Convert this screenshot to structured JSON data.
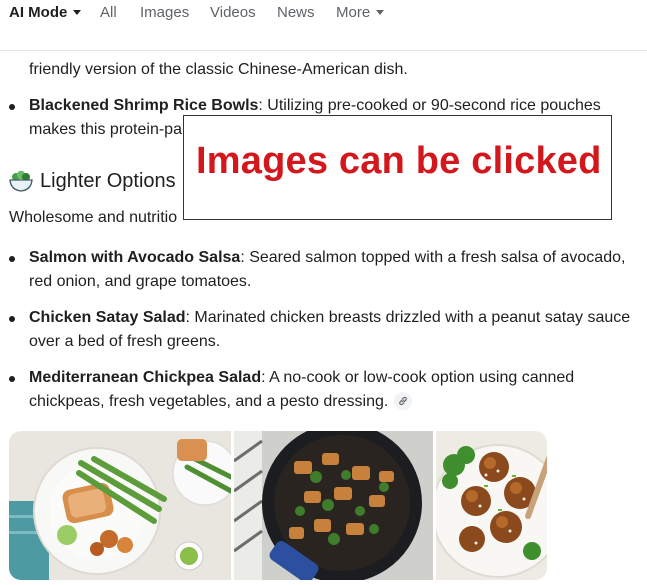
{
  "tabs": {
    "ai_mode": "AI Mode",
    "all": "All",
    "images": "Images",
    "videos": "Videos",
    "news": "News",
    "more": "More"
  },
  "previous_item": {
    "continuation": "friendly version of the classic Chinese-American dish."
  },
  "shrimp_item": {
    "title": "Blackened Shrimp Rice Bowls",
    "text_line1": ": Utilizing pre-cooked or 90-second rice pouches",
    "text_line2": "makes this protein-pa"
  },
  "section": {
    "heading": "Lighter Options",
    "intro": "Wholesome and nutritio",
    "icon": "salad-bowl-icon"
  },
  "lighter_items": [
    {
      "title": "Salmon with Avocado Salsa",
      "line1": ": Seared salmon topped with a fresh salsa of avocado,",
      "line2": "red onion, and grape tomatoes."
    },
    {
      "title": "Chicken Satay Salad",
      "line1": ": Marinated chicken breasts drizzled with a peanut satay sauce",
      "line2": "over a bed of fresh greens."
    },
    {
      "title": "Mediterranean Chickpea Salad",
      "line1": ": A no-cook or low-cook option using canned",
      "line2": "chickpeas, fresh vegetables, and a pesto dressing."
    }
  ],
  "overlay": {
    "text": "Images can be clicked",
    "color": "#d2171d"
  },
  "images": [
    {
      "subject": "salmon-asparagus-plate"
    },
    {
      "subject": "chicken-broccoli-skillet"
    },
    {
      "subject": "glazed-meatballs-broccoli-bowl"
    }
  ]
}
